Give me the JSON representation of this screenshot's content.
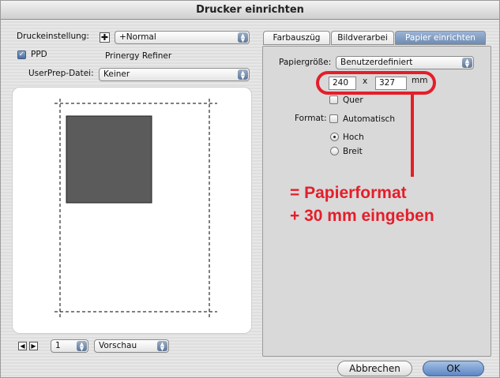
{
  "window": {
    "title": "Drucker einrichten"
  },
  "left": {
    "druckeinstellung_label": "Druckeinstellung:",
    "druckeinstellung_value": "+Normal",
    "ppd_label": "PPD",
    "ppd_value": "Prinergy Refiner",
    "userprep_label": "UserPrep-Datei:",
    "userprep_value": "Keiner"
  },
  "bottom": {
    "page_value": "1",
    "view_value": "Vorschau"
  },
  "tabs": [
    {
      "label": "Farbauszüg",
      "active": false
    },
    {
      "label": "Bildverarbei",
      "active": false
    },
    {
      "label": "Papier einrichten",
      "active": true
    }
  ],
  "paper": {
    "size_label": "Papiergröße:",
    "size_value": "Benutzerdefiniert",
    "width": "240",
    "x_sep": "x",
    "height": "327",
    "unit": "mm",
    "quer_label": "Quer",
    "format_label": "Format:",
    "automatisch_label": "Automatisch",
    "hoch_label": "Hoch",
    "breit_label": "Breit"
  },
  "annotation": {
    "line1": "= Papierformat",
    "line2": "+ 30 mm eingeben",
    "color": "#e41e2a"
  },
  "buttons": {
    "cancel": "Abbrechen",
    "ok": "OK"
  }
}
